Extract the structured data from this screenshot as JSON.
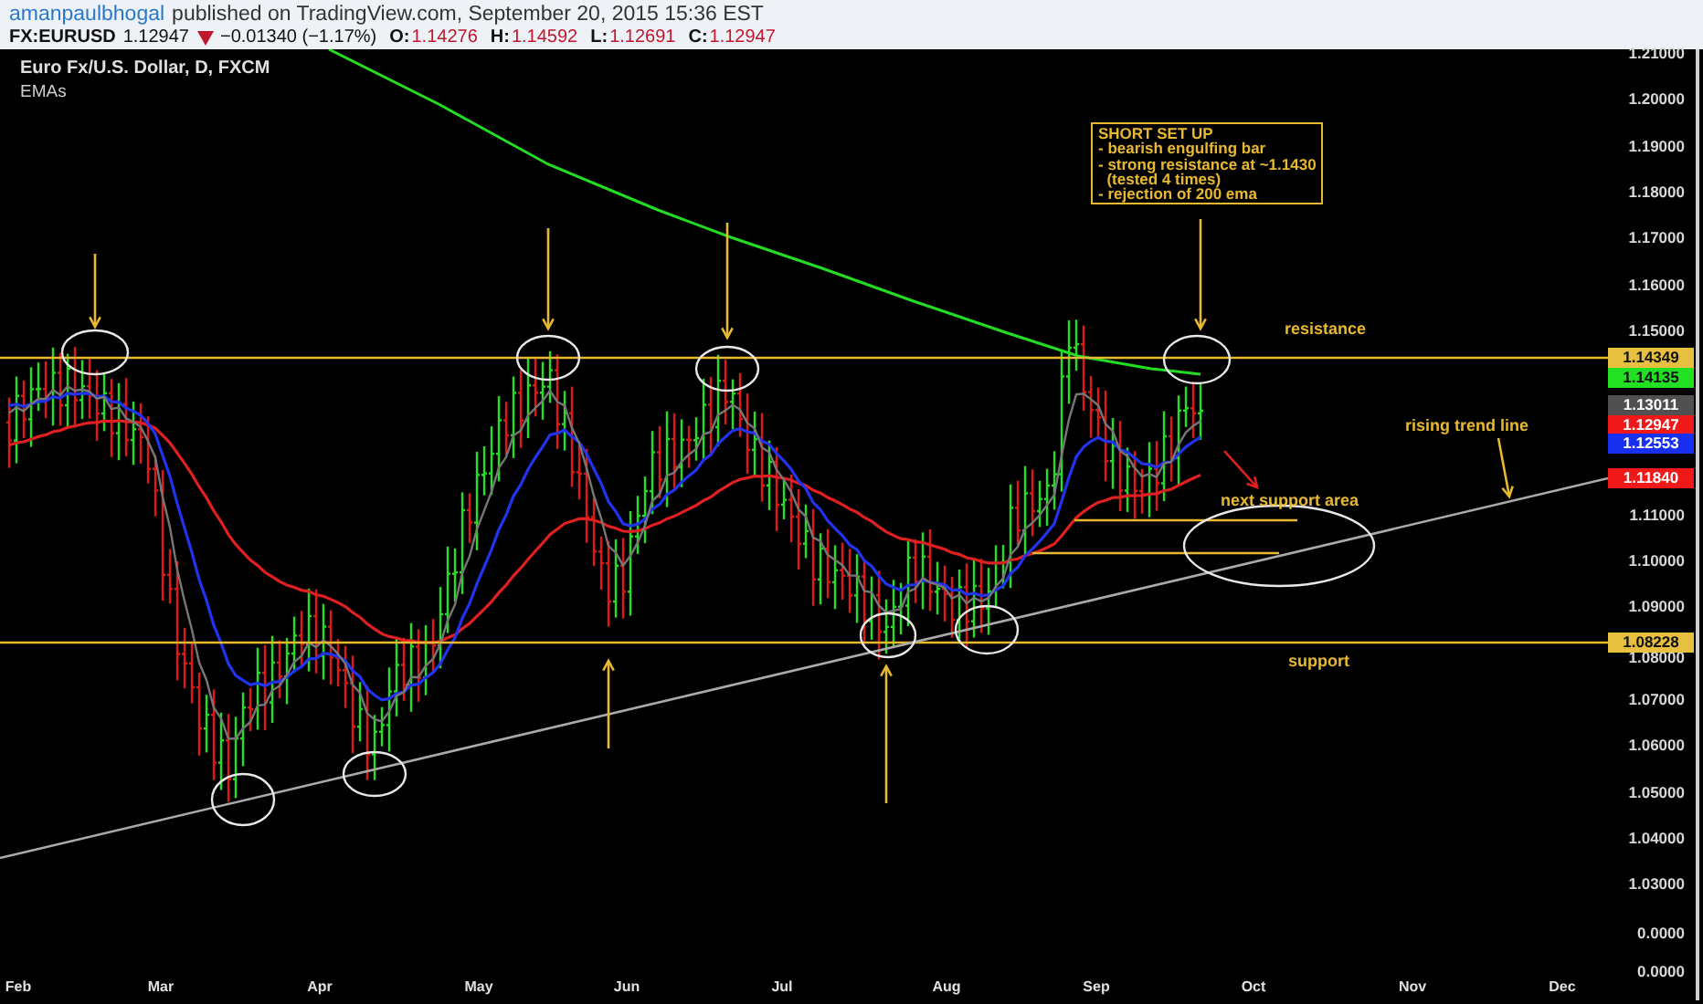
{
  "header": {
    "author": "amanpaulbhogal",
    "published": "published on TradingView.com, September 20, 2015 15:36 EST"
  },
  "quote": {
    "symbol": "FX:EURUSD",
    "last": "1.12947",
    "falling": true,
    "change": "−0.01340 (−1.17%)",
    "ohlc": [
      {
        "label": "O:",
        "value": "1.14276"
      },
      {
        "label": "H:",
        "value": "1.14592"
      },
      {
        "label": "L:",
        "value": "1.12691"
      },
      {
        "label": "C:",
        "value": "1.12947"
      }
    ]
  },
  "chart": {
    "title": "Euro Fx/U.S. Dollar, D, FXCM",
    "study": "EMAs",
    "price_axis": [
      "1.21000",
      "1.20000",
      "1.19000",
      "1.18000",
      "1.17000",
      "1.16000",
      "1.15000",
      "1.11000",
      "1.10000",
      "1.09000",
      "1.08000",
      "1.07000",
      "1.06000",
      "1.05000",
      "1.04000",
      "1.03000",
      "0.0000",
      "0.0000"
    ],
    "price_tags": [
      {
        "value": "1.14349",
        "color": "#e8c040"
      },
      {
        "value": "1.14135",
        "color": "#22e022"
      },
      {
        "value": "1.13011",
        "color": "#505050"
      },
      {
        "value": "1.12947",
        "color": "#f01818"
      },
      {
        "value": "1.12553",
        "color": "#1830f0"
      },
      {
        "value": "1.11840",
        "color": "#f01818"
      },
      {
        "value": "1.08228",
        "color": "#e8c040"
      }
    ],
    "time_axis": [
      "Feb",
      "Mar",
      "Apr",
      "May",
      "Jun",
      "Jul",
      "Aug",
      "Sep",
      "Oct",
      "Nov",
      "Dec"
    ],
    "notes": [
      {
        "kind": "box",
        "lines": [
          "SHORT SET UP",
          "- bearish engulfing bar",
          "- strong resistance at ~1.1430",
          "  (tested 4 times)",
          "- rejection of 200 ema"
        ]
      },
      {
        "kind": "label",
        "text": "resistance"
      },
      {
        "kind": "label",
        "text": "rising trend line"
      },
      {
        "kind": "label",
        "text": "next support area"
      },
      {
        "kind": "label",
        "text": "support"
      }
    ]
  }
}
